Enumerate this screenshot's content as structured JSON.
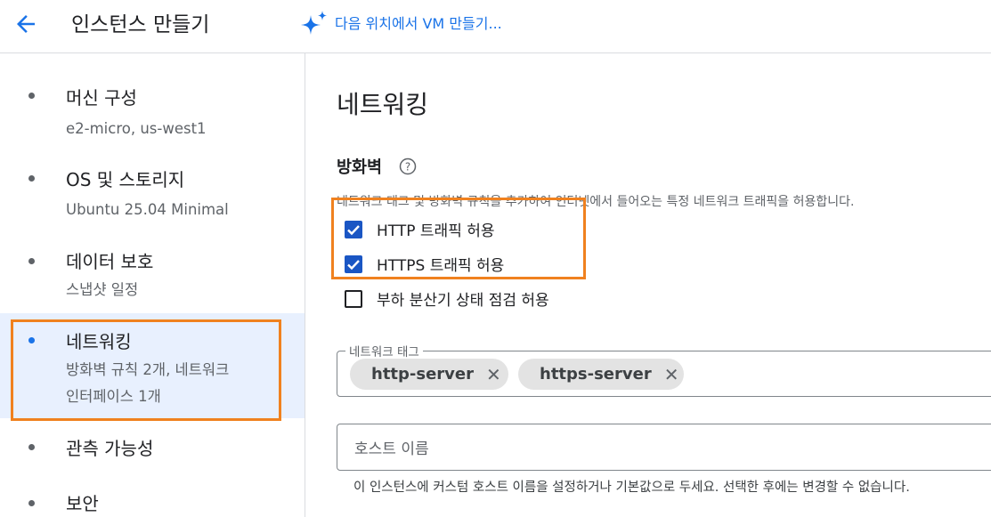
{
  "header": {
    "title": "인스턴스 만들기",
    "ai_link": "다음 위치에서 VM 만들기...",
    "icons": [
      "back-arrow-icon",
      "sparkle-icon"
    ],
    "accent_color": "#1a73e8"
  },
  "sidebar": {
    "items": [
      {
        "title": "머신 구성",
        "subtitle": "e2-micro, us-west1"
      },
      {
        "title": "OS 및 스토리지",
        "subtitle": "Ubuntu 25.04 Minimal"
      },
      {
        "title": "데이터 보호",
        "subtitle": "스냅샷 일정"
      },
      {
        "title": "네트워킹",
        "subtitle_line1": "방화벽 규칙 2개, 네트워크",
        "subtitle_line2": "인터페이스 1개",
        "active": true
      },
      {
        "title": "관측 가능성"
      },
      {
        "title": "보안"
      }
    ],
    "highlight_color": "#f0811f"
  },
  "main": {
    "section_title": "네트워킹",
    "firewall": {
      "title": "방화벽",
      "description": "네트워크 태그 및 방화벽 규칙을 추가하여 인터넷에서 들어오는 특정 네트워크 트래픽을 허용합니다.",
      "checkboxes": [
        {
          "label": "HTTP 트래픽 허용",
          "checked": true
        },
        {
          "label": "HTTPS 트래픽 허용",
          "checked": true
        },
        {
          "label": "부하 분산기 상태 점검 허용",
          "checked": false
        }
      ]
    },
    "network_tags": {
      "label": "네트워크 태그",
      "chips": [
        "http-server",
        "https-server"
      ],
      "remove_glyph": "✕"
    },
    "hostname": {
      "placeholder": "호스트 이름",
      "help": "이 인스턴스에 커스텀 호스트 이름을 설정하거나 기본값으로 두세요. 선택한 후에는 변경할 수 없습니다."
    }
  }
}
